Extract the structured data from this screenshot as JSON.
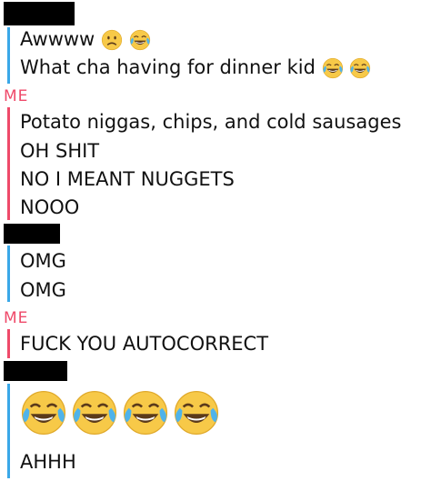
{
  "header_1": {
    "redacted": true
  },
  "messages_1": [
    {
      "text": "Awwww"
    },
    {
      "text": "What cha having for dinner kid"
    }
  ],
  "sender_me_1": "ME",
  "messages_2": [
    "Potato niggas, chips, and cold sausages",
    "OH SHIT",
    "NO I MEANT NUGGETS",
    "NOOO"
  ],
  "messages_3": [
    "OMG",
    "OMG"
  ],
  "sender_me_2": "ME",
  "messages_4": [
    "FUCK YOU AUTOCORRECT"
  ],
  "messages_5": [
    "AHHH"
  ],
  "emojis": {
    "frowning": "frowning-face-emoji",
    "laughing": "tears-of-joy-emoji"
  },
  "colors": {
    "friend_bar": "#3aa8e8",
    "me_bar": "#ef4a6a",
    "me_label": "#ef4a6a"
  }
}
